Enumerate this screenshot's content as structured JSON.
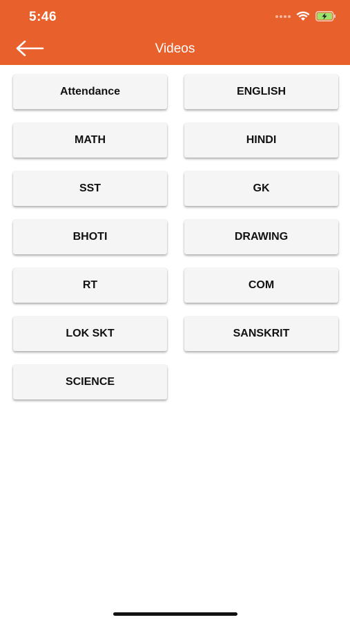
{
  "status_bar": {
    "time": "5:46"
  },
  "header": {
    "title": "Videos",
    "back_icon": "arrow-left-icon",
    "background_color": "#E8612C"
  },
  "subjects": [
    {
      "label": "Attendance"
    },
    {
      "label": "ENGLISH"
    },
    {
      "label": "MATH"
    },
    {
      "label": "HINDI"
    },
    {
      "label": "SST"
    },
    {
      "label": "GK"
    },
    {
      "label": "BHOTI"
    },
    {
      "label": "DRAWING"
    },
    {
      "label": "RT"
    },
    {
      "label": "COM"
    },
    {
      "label": "LOK SKT"
    },
    {
      "label": "SANSKRIT"
    },
    {
      "label": "SCIENCE"
    }
  ]
}
